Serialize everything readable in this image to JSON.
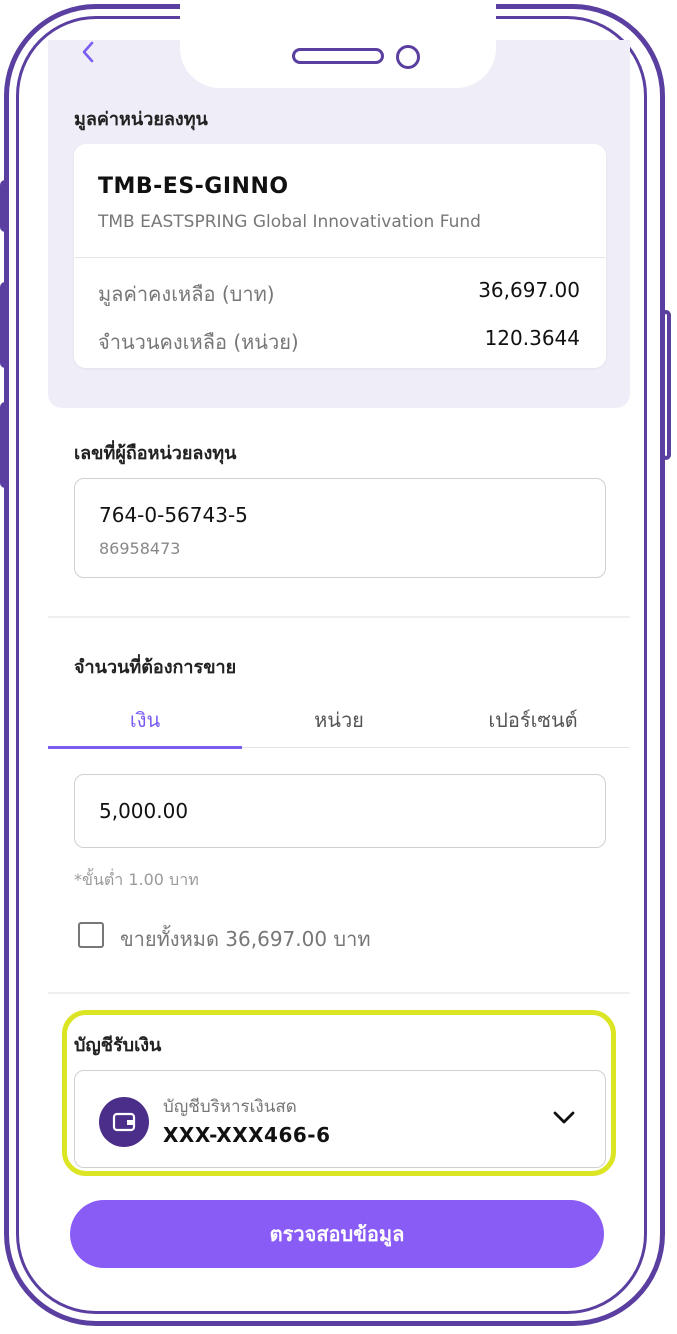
{
  "nav": {
    "back_icon": "chevron-left-icon"
  },
  "fund_section": {
    "title": "มูลค่าหน่วยลงทุน",
    "code": "TMB-ES-GINNO",
    "name": "TMB EASTSPRING Global Innovativation Fund",
    "rows": [
      {
        "label": "มูลค่าคงเหลือ (บาท)",
        "value": "36,697.00"
      },
      {
        "label": "จำนวนคงเหลือ (หน่วย)",
        "value": "120.3644"
      }
    ]
  },
  "holder_section": {
    "title": "เลขที่ผู้ถือหน่วยลงทุน",
    "account_number": "764-0-56743-5",
    "account_sub": "86958473"
  },
  "sell_section": {
    "title": "จำนวนที่ต้องการขาย",
    "tabs": [
      {
        "label": "เงิน",
        "active": true
      },
      {
        "label": "หน่วย",
        "active": false
      },
      {
        "label": "เปอร์เซนต์",
        "active": false
      }
    ],
    "amount_value": "5,000.00",
    "min_hint": "*ขั้นต่ำ 1.00 บาท",
    "sell_all_label": "ขายทั้งหมด 36,697.00 บาท",
    "sell_all_checked": false
  },
  "receive_section": {
    "title": "บัญชีรับเงิน",
    "account_type": "บัญชีบริหารเงินสด",
    "account_number": "XXX-XXX466-6",
    "icon": "wallet-icon",
    "dropdown_icon": "chevron-down-icon"
  },
  "cta": {
    "label": "ตรวจสอบข้อมูล"
  },
  "colors": {
    "accent": "#7b5cf0",
    "button": "#8a5cf6",
    "frame": "#5a3fa0",
    "highlight": "#dce524",
    "header_bg": "#efeef8"
  }
}
